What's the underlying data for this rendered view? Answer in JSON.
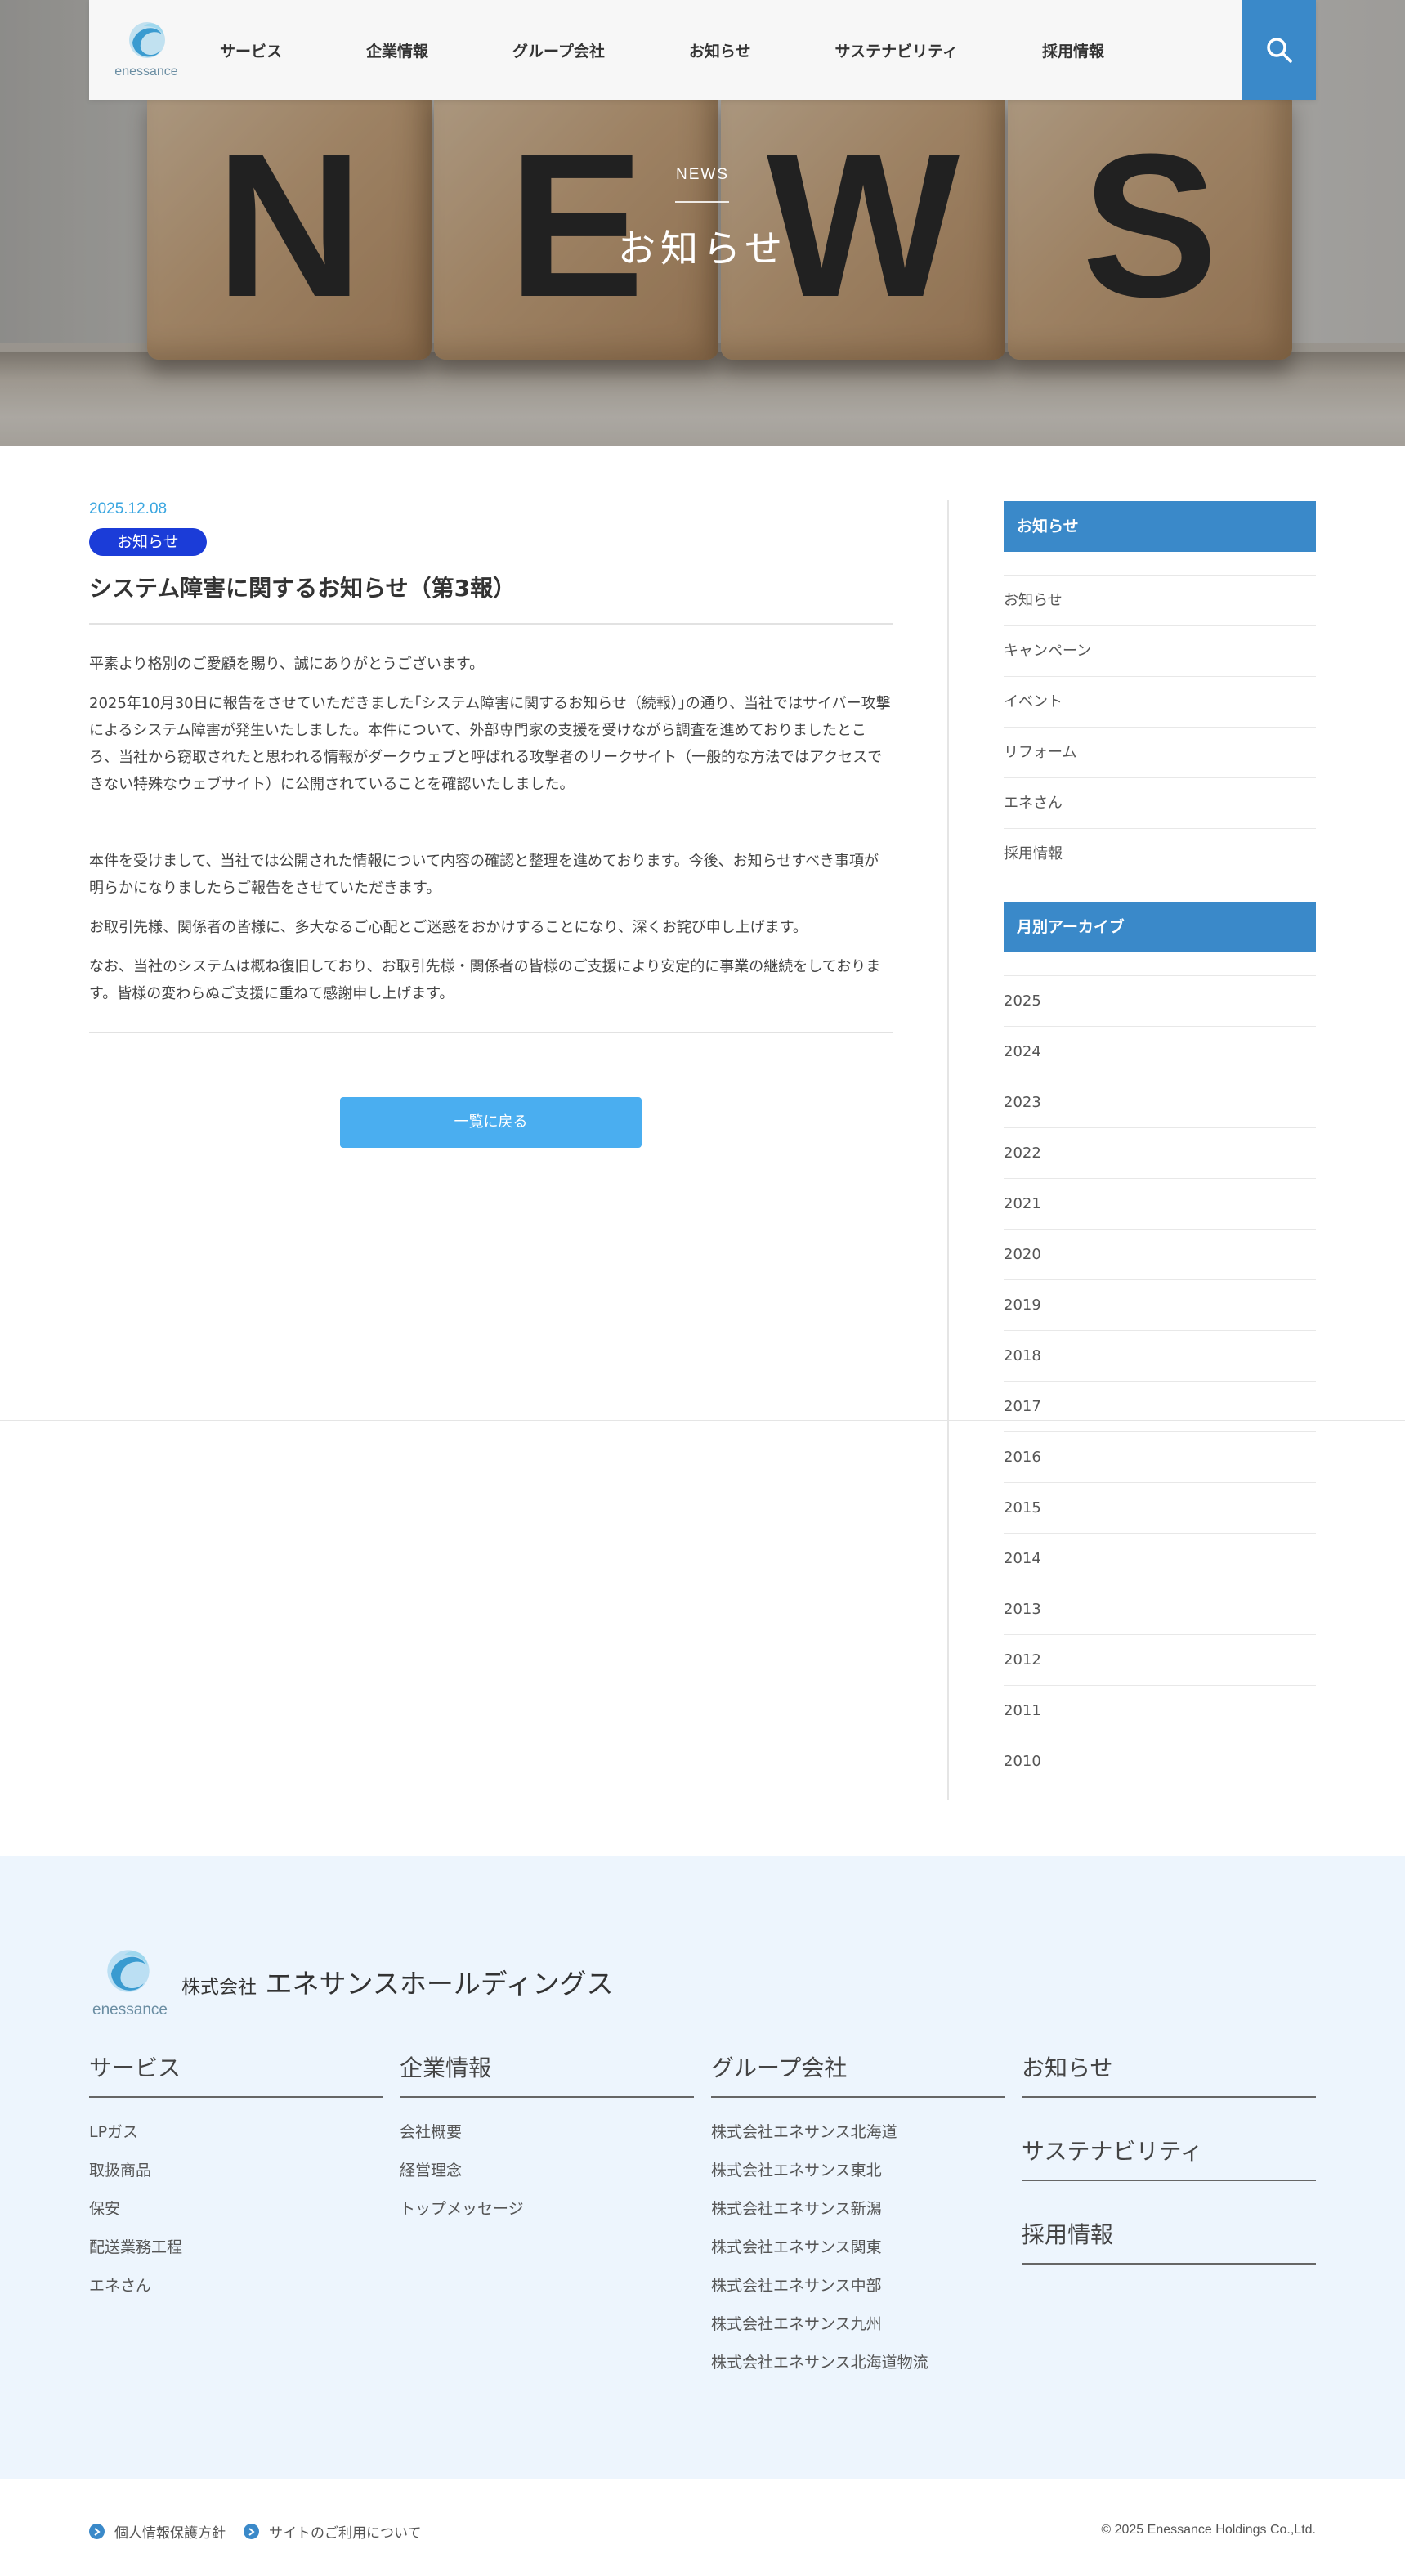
{
  "header": {
    "logo_text": "enessance",
    "nav": [
      "サービス",
      "企業情報",
      "グループ会社",
      "お知らせ",
      "サステナビリティ",
      "採用情報"
    ]
  },
  "hero": {
    "blocks": [
      "N",
      "E",
      "W",
      "S"
    ],
    "label_en": "NEWS",
    "label_ja": "お知らせ"
  },
  "article": {
    "date": "2025.12.08",
    "badge": "お知らせ",
    "title": "システム障害に関するお知らせ（第3報）",
    "paragraphs": [
      "平素より格別のご愛顧を賜り、誠にありがとうございます。",
      "2025年10月30日に報告をさせていただきました｢システム障害に関するお知らせ（続報）｣の通り、当社ではサイバー攻撃によるシステム障害が発生いたしました。本件について、外部専門家の支援を受けながら調査を進めておりましたところ、当社から窃取されたと思われる情報がダークウェブと呼ばれる攻撃者のリークサイト（一般的な方法ではアクセスできない特殊なウェブサイト）に公開されていることを確認いたしました。",
      "本件を受けまして、当社では公開された情報について内容の確認と整理を進めております。今後、お知らせすべき事項が明らかになりましたらご報告をさせていただきます。",
      "お取引先様、関係者の皆様に、多大なるご心配とご迷惑をおかけすることになり、深くお詫び申し上げます。",
      "なお、当社のシステムは概ね復旧しており、お取引先様・関係者の皆様のご支援により安定的に事業の継続をしております。皆様の変わらぬご支援に重ねて感謝申し上げます。"
    ],
    "back_label": "一覧に戻る"
  },
  "sidebar": {
    "category_title": "お知らせ",
    "categories": [
      "お知らせ",
      "キャンペーン",
      "イベント",
      "リフォーム",
      "エネさん",
      "採用情報"
    ],
    "archive_title": "月別アーカイブ",
    "archives": [
      "2025",
      "2024",
      "2023",
      "2022",
      "2021",
      "2020",
      "2019",
      "2018",
      "2017",
      "2016",
      "2015",
      "2014",
      "2013",
      "2012",
      "2011",
      "2010"
    ]
  },
  "footer": {
    "logo_text": "enessance",
    "company_prefix": "株式会社",
    "company_name": "エネサンスホールディングス",
    "columns": [
      {
        "title": "サービス",
        "items": [
          "LPガス",
          "取扱商品",
          "保安",
          "配送業務工程",
          "エネさん"
        ]
      },
      {
        "title": "企業情報",
        "items": [
          "会社概要",
          "経営理念",
          "トップメッセージ"
        ]
      },
      {
        "title": "グループ会社",
        "items": [
          "株式会社エネサンス北海道",
          "株式会社エネサンス東北",
          "株式会社エネサンス新潟",
          "株式会社エネサンス関東",
          "株式会社エネサンス中部",
          "株式会社エネサンス九州",
          "株式会社エネサンス北海道物流"
        ]
      }
    ],
    "links": [
      "お知らせ",
      "サステナビリティ",
      "採用情報"
    ]
  },
  "bottom": {
    "privacy": "個人情報保護方針",
    "terms": "サイトのご利用について",
    "copyright": "© 2025 Enessance Holdings Co.,Ltd."
  },
  "colors": {
    "brand_blue": "#3a89c9",
    "badge_blue": "#1b3cd8",
    "button_blue": "#4aaef0",
    "date_blue": "#3aa6e0",
    "footer_bg": "#edf5fd"
  }
}
